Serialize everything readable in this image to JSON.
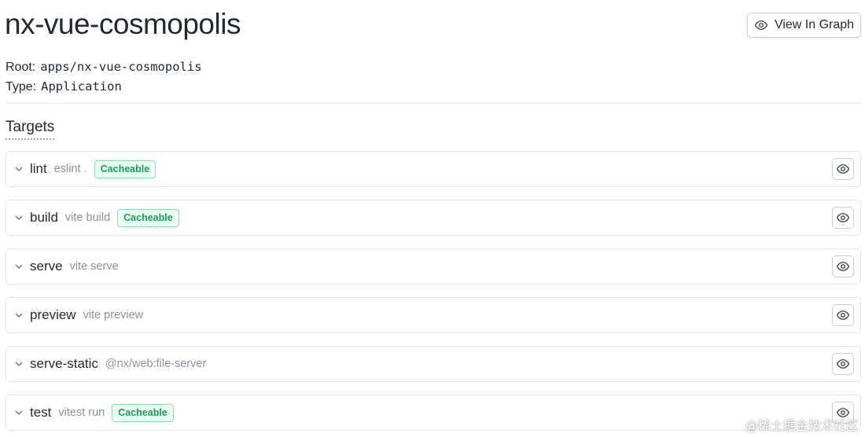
{
  "project": {
    "name": "nx-vue-cosmopolis",
    "root_label": "Root:",
    "root_value": "apps/nx-vue-cosmopolis",
    "type_label": "Type:",
    "type_value": "Application"
  },
  "header": {
    "view_graph_label": "View In Graph",
    "view_graph_icon": "eye-icon"
  },
  "targets_section": {
    "title": "Targets"
  },
  "targets": [
    {
      "name": "lint",
      "command": "eslint .",
      "badge": "Cacheable"
    },
    {
      "name": "build",
      "command": "vite build",
      "badge": "Cacheable"
    },
    {
      "name": "serve",
      "command": "vite serve",
      "badge": ""
    },
    {
      "name": "preview",
      "command": "vite preview",
      "badge": ""
    },
    {
      "name": "serve-static",
      "command": "@nx/web:file-server",
      "badge": ""
    },
    {
      "name": "test",
      "command": "vitest run",
      "badge": "Cacheable"
    }
  ],
  "colors": {
    "badge_text": "#15a059",
    "badge_bg": "#ecfdf3",
    "badge_border": "#86e0ac",
    "border": "#e2e5ea"
  },
  "watermark": "@稀土掘金技术社区"
}
